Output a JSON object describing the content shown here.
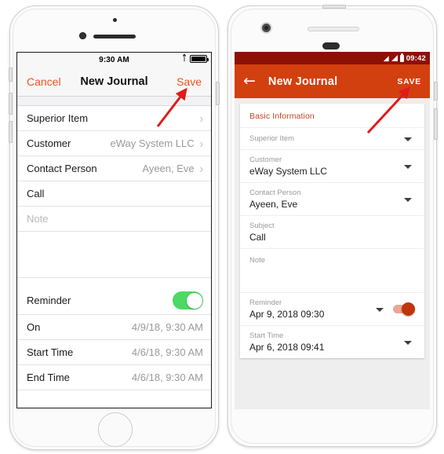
{
  "ios": {
    "status": {
      "time": "9:30 AM",
      "bluetooth_icon": "bluetooth-icon",
      "battery_icon": "battery-icon"
    },
    "navbar": {
      "cancel_label": "Cancel",
      "title": "New Journal",
      "save_label": "Save"
    },
    "rows": [
      {
        "label": "Superior Item",
        "value": "",
        "chevron": "›",
        "type": "disclosure"
      },
      {
        "label": "Customer",
        "value": "eWay System LLC",
        "chevron": "›",
        "type": "disclosure"
      },
      {
        "label": "Contact Person",
        "value": "Ayeen,  Eve",
        "chevron": "›",
        "type": "disclosure"
      },
      {
        "label": "Call",
        "value": "",
        "chevron": "",
        "type": "text"
      },
      {
        "label": "Note",
        "value": "",
        "chevron": "",
        "type": "placeholder"
      }
    ],
    "reminder_rows": [
      {
        "label": "Reminder",
        "value": "",
        "type": "switch",
        "switch_on": true
      },
      {
        "label": "On",
        "value": "4/9/18, 9:30 AM",
        "type": "value"
      },
      {
        "label": "Start Time",
        "value": "4/6/18, 9:30 AM",
        "type": "value"
      },
      {
        "label": "End Time",
        "value": "4/6/18, 9:30 AM",
        "type": "value"
      }
    ],
    "colors": {
      "accent": "#f4511e",
      "switch_on": "#4cd964",
      "value_text": "#9a9a9f"
    }
  },
  "android": {
    "status": {
      "wifi_icon": "wifi-icon",
      "signal_icon": "signal-icon",
      "battery_icon": "battery-icon",
      "clock": "09:42"
    },
    "appbar": {
      "back_icon": "←",
      "title": "New Journal",
      "save_label": "SAVE"
    },
    "section_title": "Basic Information",
    "fields": [
      {
        "label": "Superior Item",
        "value": "",
        "caret": true
      },
      {
        "label": "Customer",
        "value": "eWay System LLC",
        "caret": true
      },
      {
        "label": "Contact Person",
        "value": "Ayeen,  Eve",
        "caret": true
      },
      {
        "label": "Subject",
        "value": "Call",
        "caret": false
      },
      {
        "label": "Note",
        "value": "",
        "caret": false,
        "multiline": true
      },
      {
        "label": "Reminder",
        "value": "Apr 9, 2018  09:30",
        "caret": true,
        "switch": true,
        "switch_on": true
      },
      {
        "label": "Start Time",
        "value": "Apr 6, 2018  09:41",
        "caret": true
      }
    ],
    "colors": {
      "statusbar": "#8d1007",
      "appbar": "#d2400f",
      "section_title": "#c0461f",
      "switch_on": "#bf360c"
    }
  },
  "annotations": {
    "arrow_color": "#e01b1b",
    "ios_arrow_target": "Save",
    "android_arrow_target": "SAVE"
  }
}
